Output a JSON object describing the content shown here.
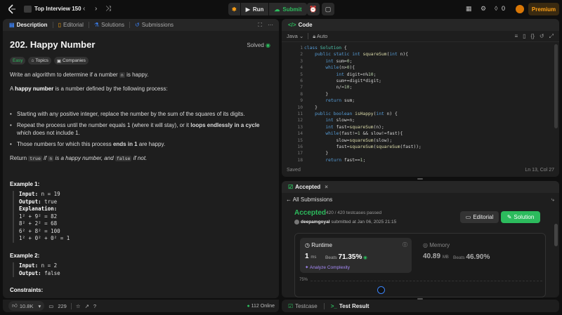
{
  "topbar": {
    "title": "Top Interview 150",
    "run_label": "Run",
    "submit_label": "Submit",
    "streak_count": "0",
    "premium_label": "Premium"
  },
  "desc_tabs": [
    "Description",
    "Editorial",
    "Solutions",
    "Submissions"
  ],
  "problem": {
    "title": "202. Happy Number",
    "status": "Solved",
    "chips": [
      "Easy",
      "Topics",
      "Companies"
    ],
    "intro_a": "Write an algorithm to determine if a number ",
    "intro_code": "n",
    "intro_b": " is happy.",
    "def_a": "A ",
    "def_bold": "happy number",
    "def_b": " is a number defined by the following process:",
    "bullets": [
      {
        "a": "Starting with any positive integer, replace the number by the sum of the squares of its digits.",
        "bold": "",
        "b": ""
      },
      {
        "a": "Repeat the process until the number equals 1 (where it will stay), or it ",
        "bold": "loops endlessly in a cycle",
        "b": " which does not include 1."
      },
      {
        "a": "Those numbers for which this process ",
        "bold": "ends in 1",
        "b": " are happy."
      }
    ],
    "return_a": "Return ",
    "return_true": "true",
    "return_b": " if ",
    "return_n": "n",
    "return_c": " is a happy number, and ",
    "return_false": "false",
    "return_d": " if not.",
    "example1_title": "Example 1:",
    "example1": {
      "input_label": "Input:",
      "input": " n = 19",
      "output_label": "Output:",
      "output": " true",
      "expl_label": "Explanation:",
      "lines": [
        "1² + 9² = 82",
        "8² + 2² = 68",
        "6² + 8² = 100",
        "1² + 0² + 0² = 1"
      ]
    },
    "example2_title": "Example 2:",
    "example2": {
      "input_label": "Input:",
      "input": " n = 2",
      "output_label": "Output:",
      "output": " false"
    },
    "constraints_title": "Constraints:"
  },
  "footer": {
    "likes": "10.8K",
    "comments": "229",
    "online": "112 Online"
  },
  "code_panel": {
    "tab": "Code",
    "language": "Java",
    "mode": "Auto",
    "status": "Saved",
    "cursor": "Ln 13, Col 27",
    "line_numbers": [
      "1",
      "2",
      "3",
      "4",
      "5",
      "6",
      "7",
      "8",
      "9",
      "10",
      "11",
      "12",
      "13",
      "14",
      "15",
      "16",
      "17",
      "18",
      "19"
    ],
    "lines": [
      "class Solution {",
      "    public static int squareSum(int n){",
      "        int sum=0;",
      "        while(n>0){",
      "            int digit=n%10;",
      "            sum+=digit*digit;",
      "            n/=10;",
      "        }",
      "        return sum;",
      "    }",
      "    public boolean isHappy(int n) {",
      "        int slow=n;",
      "        int fast=squareSum(n);",
      "        while(fast!=1 && slow!=fast){",
      "            slow=squareSum(slow);",
      "            fast=squareSum(squareSum(fast));",
      "        }",
      "        return fast==1;",
      "    }"
    ]
  },
  "result_panel": {
    "tab": "Accepted",
    "back": "All Submissions",
    "verdict": "Accepted",
    "testcases": "420 / 420 testcases passed",
    "user": "deepamgoyal",
    "submitted": " submitted at Jan 06, 2025 21:15",
    "editorial_btn": "Editorial",
    "solution_btn": "Solution",
    "runtime_label": "Runtime",
    "runtime_value": "1",
    "runtime_unit": "ms",
    "beats_label": "Beats",
    "runtime_beats": "71.35%",
    "analyze": "Analyze Complexity",
    "memory_label": "Memory",
    "memory_value": "40.89",
    "memory_unit": "MB",
    "memory_beats": "46.90%",
    "chart_tick": "75%"
  },
  "bottom_tabs": [
    "Testcase",
    "Test Result"
  ],
  "colors": {
    "accent_green": "#2cbb5d",
    "premium_orange": "#ffa116",
    "panel_bg": "#1e1e1e",
    "page_bg": "#0f0f0f"
  }
}
